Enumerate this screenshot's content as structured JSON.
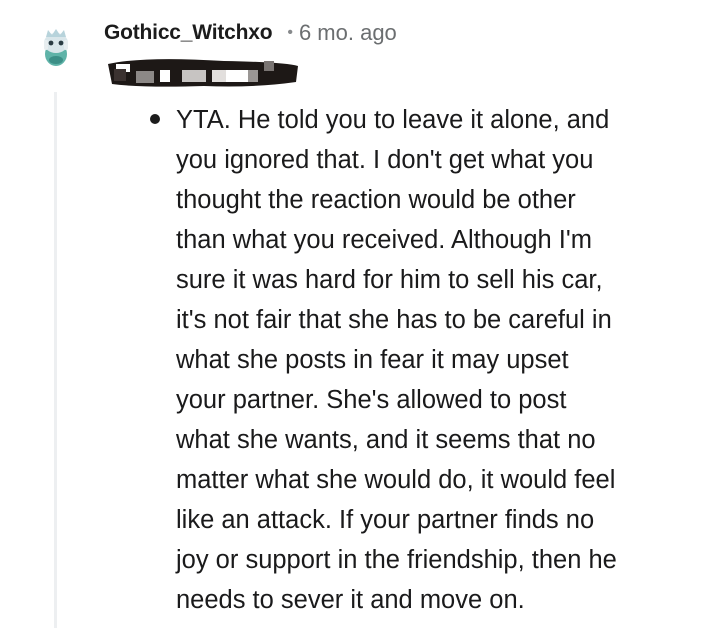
{
  "comment": {
    "username": "Gothicc_Witchxo",
    "separator": "•",
    "timestamp": "6 mo. ago",
    "avatar_icon": "snoo-avatar-icon",
    "user_flair_icon": "pixelated-flair-badge",
    "body_text": "YTA. He told you to leave it alone, and\nyou ignored that. I don't get what you\nthought the reaction would be other\nthan what you received. Although I'm\nsure it was hard for him to sell his car,\nit's not fair that she has to be careful in\nwhat she posts in fear it may upset\nyour partner. She's allowed to post\nwhat she wants, and it seems that no\nmatter what she would do, it would feel\nlike an attack. If your partner finds no\njoy or support in the friendship, then he\nneeds to sever it and move on."
  }
}
